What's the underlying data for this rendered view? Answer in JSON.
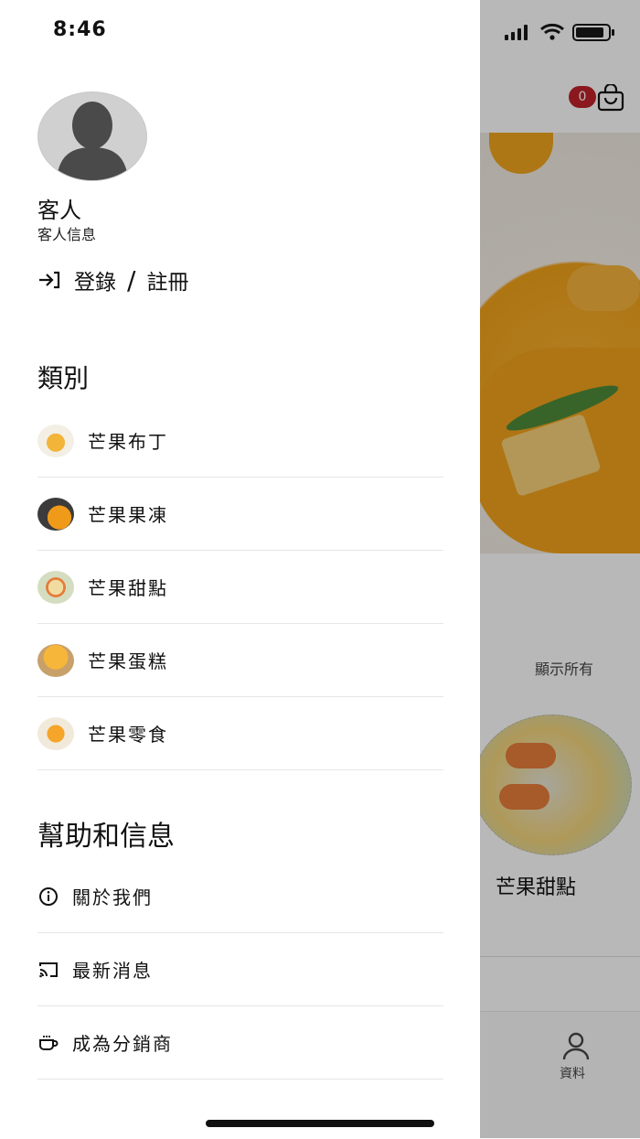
{
  "status_bar": {
    "time": "8:46"
  },
  "background": {
    "cart_count": "0",
    "show_all_label": "顯示所有",
    "category_label": "芒果甜點",
    "profile_tab_label": "資料"
  },
  "drawer": {
    "user": {
      "name": "客人",
      "info": "客人信息"
    },
    "login": {
      "label_login": "登錄",
      "separator": "/",
      "label_register": "註冊"
    },
    "categories": {
      "title": "類別",
      "items": [
        {
          "label": "芒果布丁"
        },
        {
          "label": "芒果果凍"
        },
        {
          "label": "芒果甜點"
        },
        {
          "label": "芒果蛋糕"
        },
        {
          "label": "芒果零食"
        }
      ]
    },
    "help": {
      "title": "幫助和信息",
      "items": [
        {
          "label": "關於我們",
          "icon": "info-icon"
        },
        {
          "label": "最新消息",
          "icon": "cast-icon"
        },
        {
          "label": "成為分銷商",
          "icon": "coffee-cup-icon"
        }
      ]
    }
  }
}
